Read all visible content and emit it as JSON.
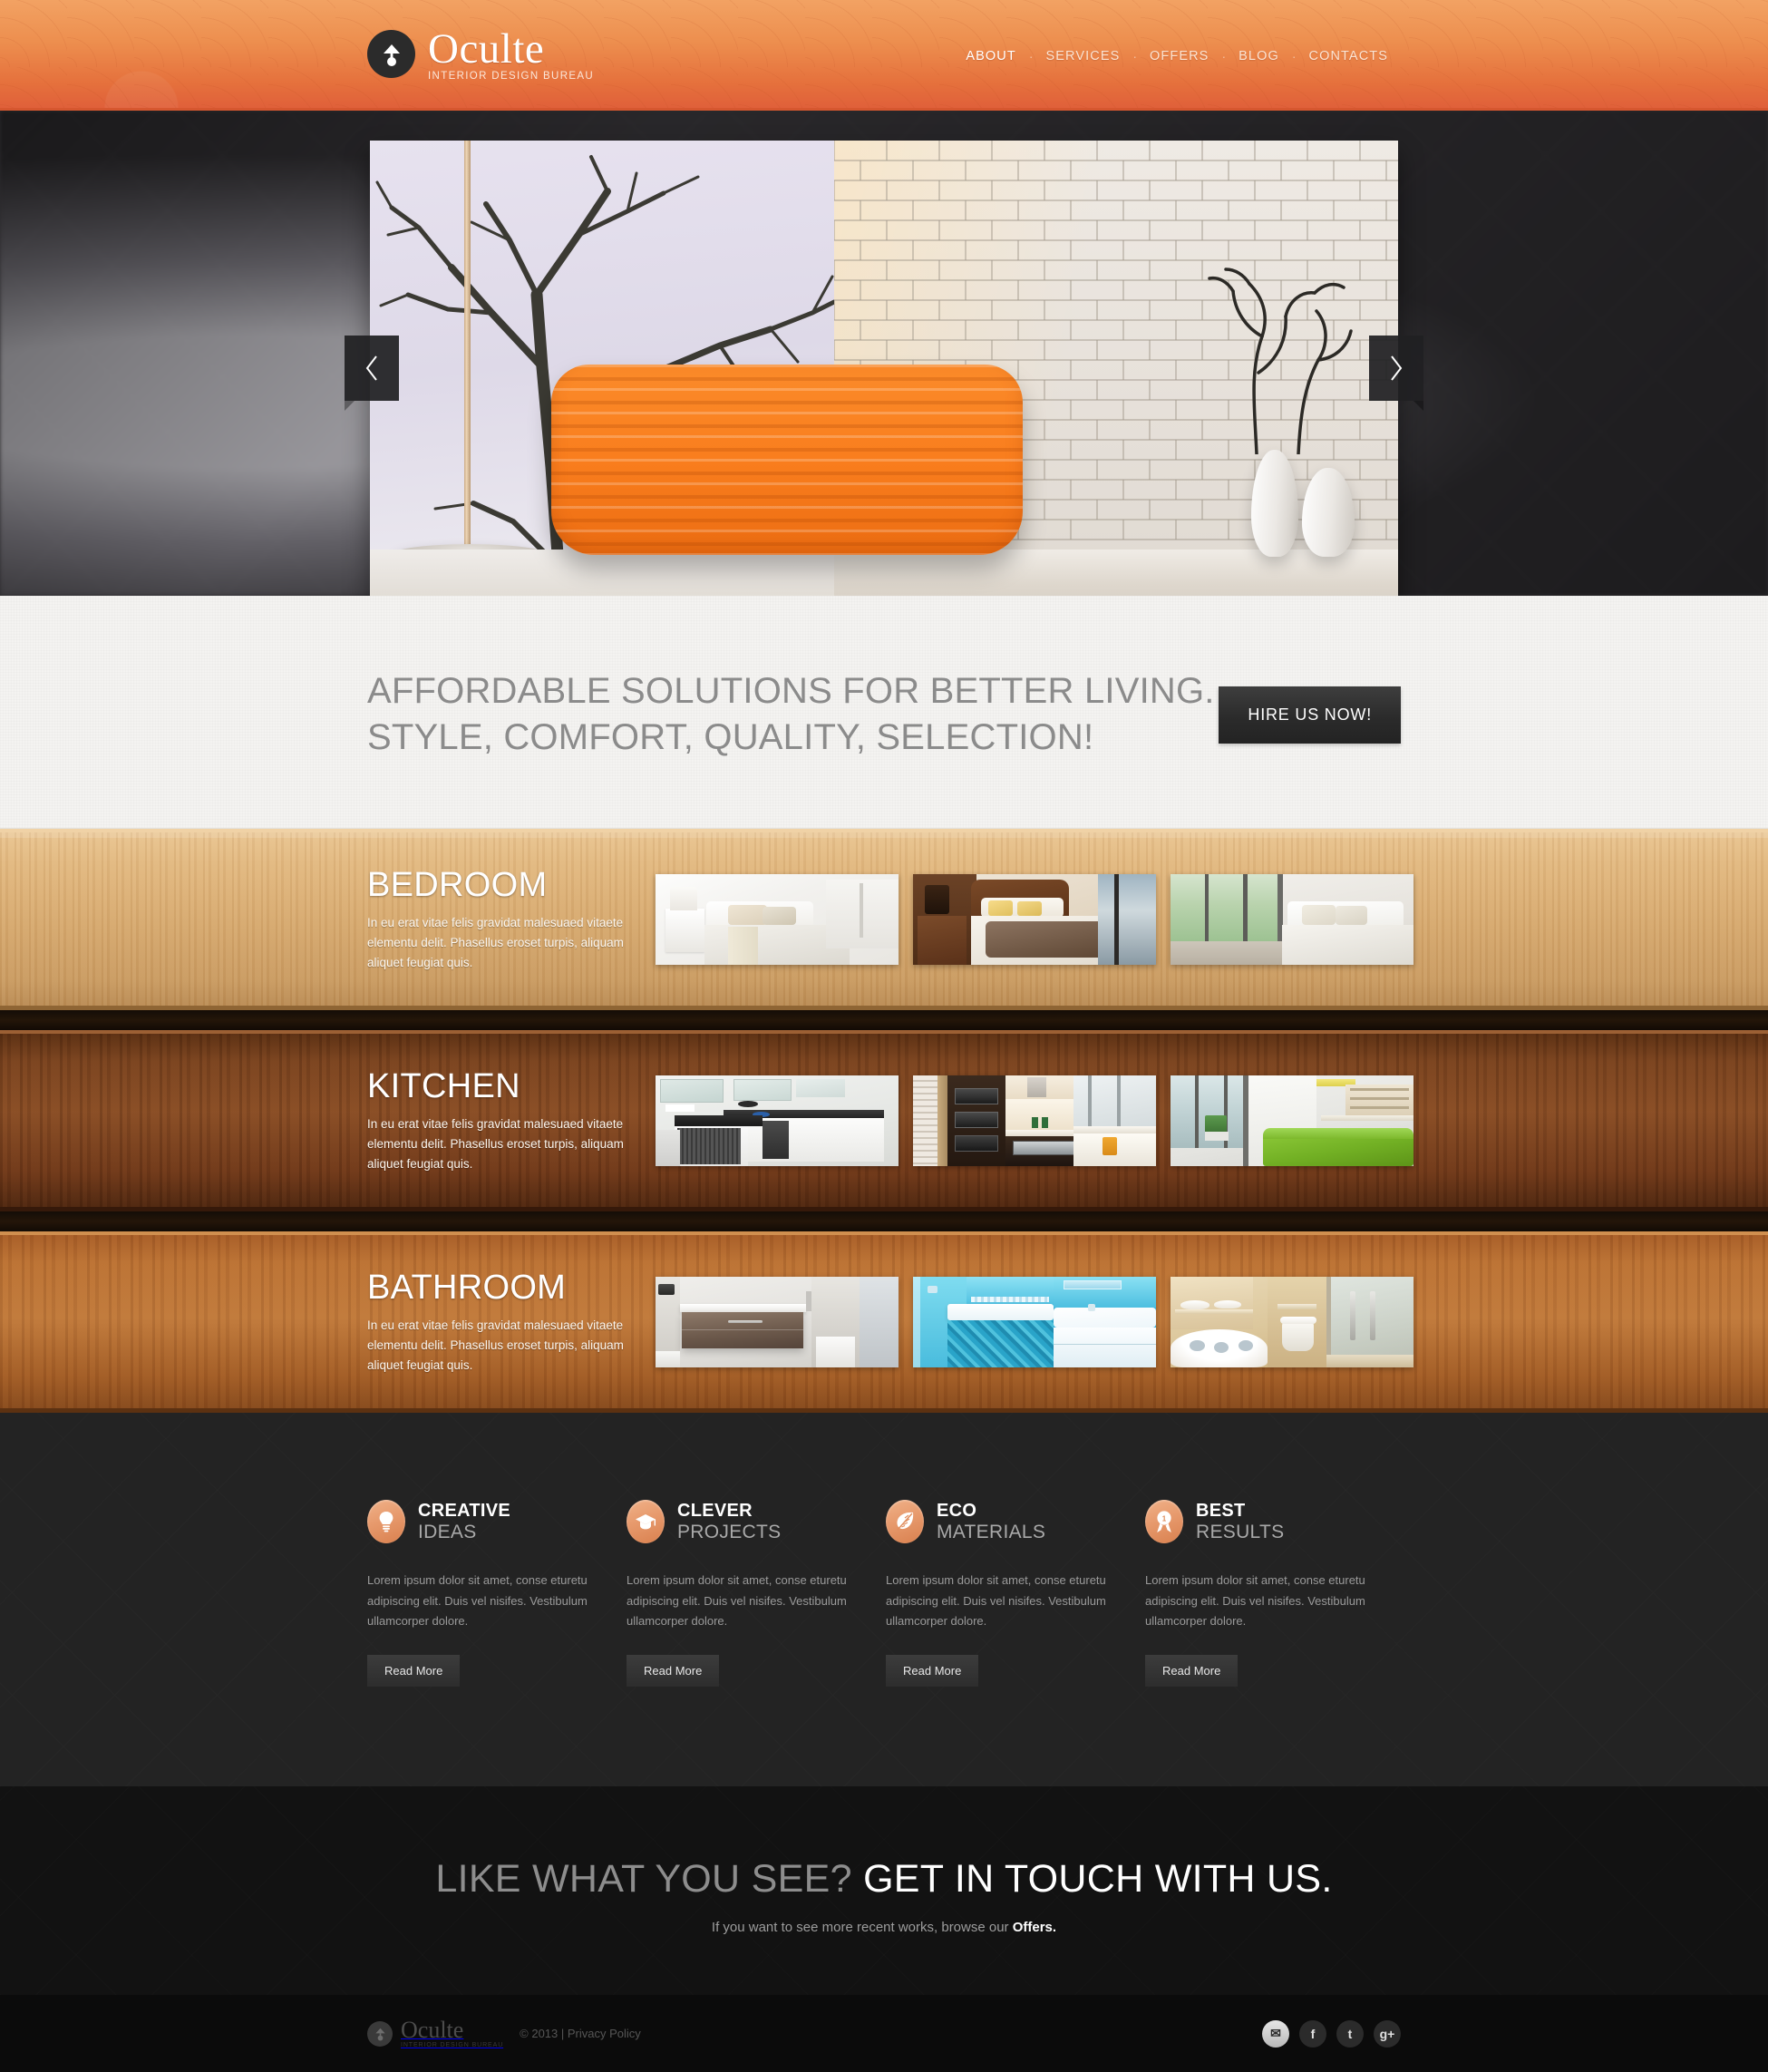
{
  "header": {
    "logo": {
      "name": "Oculte",
      "tagline": "INTERIOR DESIGN BUREAU",
      "icon": "lamp-icon"
    },
    "nav": [
      {
        "label": "ABOUT",
        "active": true
      },
      {
        "label": "SERVICES",
        "active": false
      },
      {
        "label": "OFFERS",
        "active": false
      },
      {
        "label": "BLOG",
        "active": false
      },
      {
        "label": "CONTACTS",
        "active": false
      }
    ],
    "nav_separator": "·",
    "accent_color": "#e5703c",
    "gradient_top": "#f2a263",
    "gradient_bottom": "#e0603a"
  },
  "slider": {
    "prev_label": "Previous slide",
    "next_label": "Next slide",
    "slide_alt": "Living room with orange sofa, winter tree mural and white brick wall"
  },
  "tagline": {
    "line1": "AFFORDABLE SOLUTIONS FOR BETTER LIVING.",
    "line2": "STYLE, COMFORT, QUALITY, SELECTION!",
    "button": "HIRE US NOW!"
  },
  "rooms": [
    {
      "title": "BEDROOM",
      "description": "In eu erat vitae felis gravidat malesuaed vitaete elementu delit. Phasellus eroset turpis, aliquam aliquet feugiat quis.",
      "shelf_style": "light-wood",
      "thumbs": [
        "bedroom-white-linens",
        "bedroom-wooden-sleigh-bed",
        "bedroom-glass-wall-view"
      ]
    },
    {
      "title": "KITCHEN",
      "description": "In eu erat vitae felis gravidat malesuaed vitaete elementu delit. Phasellus eroset turpis, aliquam aliquet feugiat quis.",
      "shelf_style": "dark-wood",
      "thumbs": [
        "kitchen-white-island",
        "kitchen-dark-built-in-ovens",
        "kitchen-green-sofa-open-plan"
      ]
    },
    {
      "title": "BATHROOM",
      "description": "In eu erat vitae felis gravidat malesuaed vitaete elementu delit. Phasellus eroset turpis, aliquam aliquet feugiat quis.",
      "shelf_style": "med-wood",
      "thumbs": [
        "bathroom-brown-vanity",
        "bathroom-blue-mosaic-tub",
        "bathroom-beige-jacuzzi"
      ]
    }
  ],
  "features": [
    {
      "title_bold": "CREATIVE",
      "title_light": "IDEAS",
      "icon": "lightbulb-icon",
      "text": "Lorem ipsum dolor sit amet, conse eturetu adipiscing elit. Duis vel nisifes. Vestibulum ullamcorper dolore.",
      "button": "Read More"
    },
    {
      "title_bold": "CLEVER",
      "title_light": "PROJECTS",
      "icon": "graduation-cap-icon",
      "text": "Lorem ipsum dolor sit amet, conse eturetu adipiscing elit. Duis vel nisifes. Vestibulum ullamcorper dolore.",
      "button": "Read More"
    },
    {
      "title_bold": "ECO",
      "title_light": "MATERIALS",
      "icon": "leaf-icon",
      "text": "Lorem ipsum dolor sit amet, conse eturetu adipiscing elit. Duis vel nisifes. Vestibulum ullamcorper dolore.",
      "button": "Read More"
    },
    {
      "title_bold": "BEST",
      "title_light": "RESULTS",
      "icon": "award-ribbon-icon",
      "text": "Lorem ipsum dolor sit amet, conse eturetu adipiscing elit. Duis vel nisifes. Vestibulum ullamcorper dolore.",
      "button": "Read More"
    }
  ],
  "cta": {
    "title_dim": "LIKE WHAT YOU SEE?",
    "title_bright": "GET IN TOUCH WITH US.",
    "sub_prefix": "If you want to see more recent works, browse our ",
    "sub_link": "Offers."
  },
  "footer": {
    "logo": {
      "name": "Oculte",
      "tagline": "INTERIOR DESIGN BUREAU"
    },
    "copyright": "© 2013 | Privacy Policy",
    "socials": [
      {
        "name": "email-icon",
        "glyph": "✉",
        "active": true
      },
      {
        "name": "facebook-icon",
        "glyph": "f",
        "active": false
      },
      {
        "name": "twitter-icon",
        "glyph": "t",
        "active": false
      },
      {
        "name": "googleplus-icon",
        "glyph": "g+",
        "active": false
      }
    ]
  }
}
